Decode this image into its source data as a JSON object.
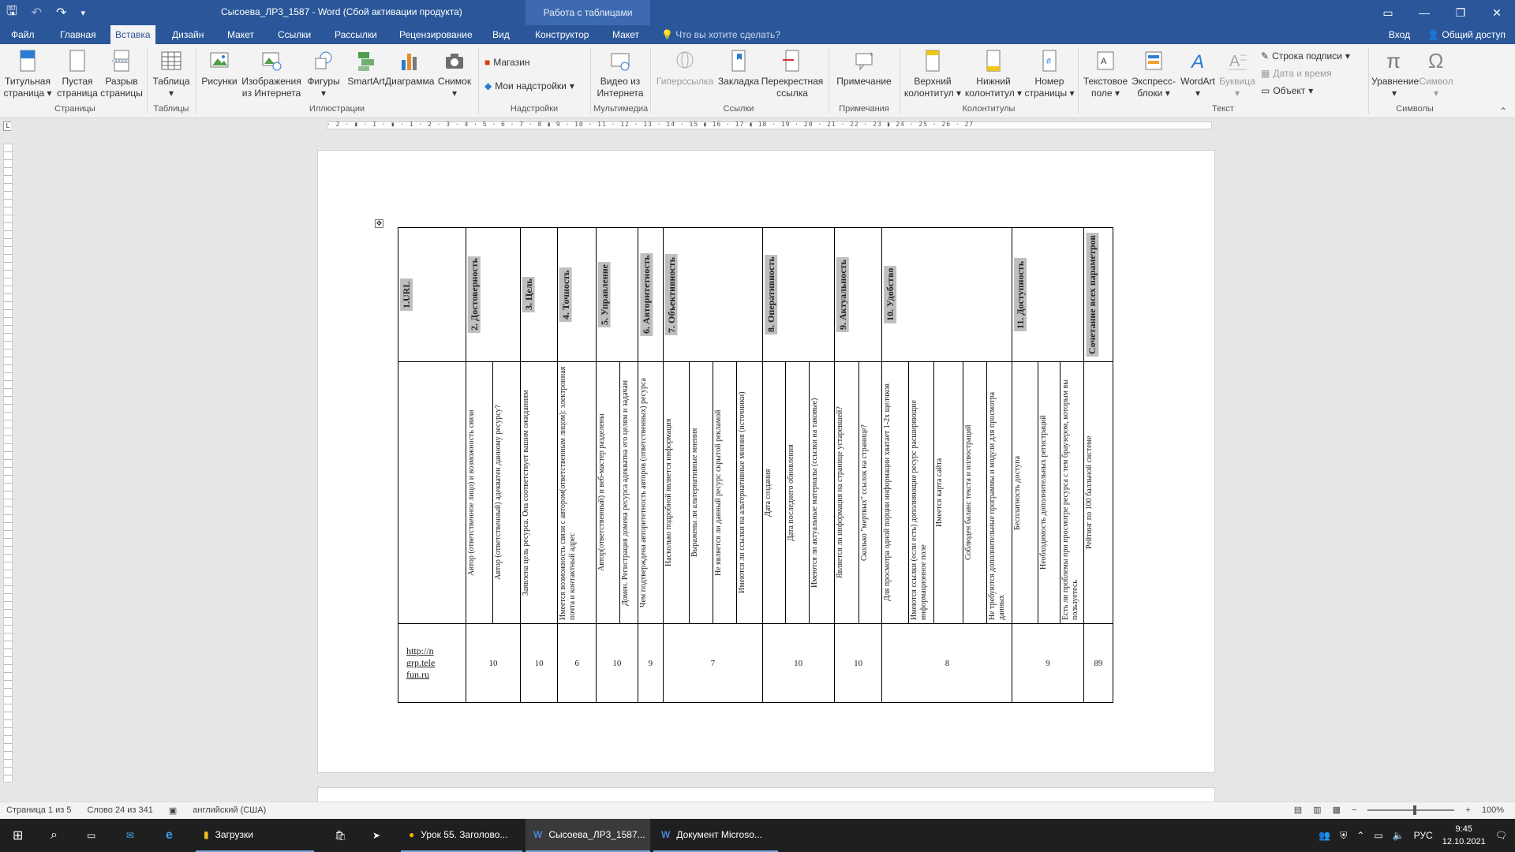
{
  "window": {
    "title": "Сысоева_ЛР3_1587 - Word (Сбой активации продукта)",
    "context_tab": "Работа с таблицами"
  },
  "tabs": [
    "Файл",
    "Главная",
    "Вставка",
    "Дизайн",
    "Макет",
    "Ссылки",
    "Рассылки",
    "Рецензирование",
    "Вид",
    "Конструктор",
    "Макет"
  ],
  "tell_me": "Что вы хотите сделать?",
  "signin": "Вход",
  "share": "Общий доступ",
  "ribbon": {
    "pages": {
      "cover": "Титульная страница",
      "blank": "Пустая страница",
      "break": "Разрыв страницы",
      "label": "Страницы"
    },
    "tables": {
      "table": "Таблица",
      "label": "Таблицы"
    },
    "illustrations": {
      "pictures": "Рисунки",
      "online": "Изображения из Интернета",
      "shapes": "Фигуры",
      "smartart": "SmartArt",
      "chart": "Диаграмма",
      "screenshot": "Снимок",
      "label": "Иллюстрации"
    },
    "addins": {
      "store": "Магазин",
      "myaddins": "Мои надстройки",
      "label": "Надстройки"
    },
    "media": {
      "video": "Видео из Интернета",
      "label": "Мультимедиа"
    },
    "links": {
      "hyperlink": "Гиперссылка",
      "bookmark": "Закладка",
      "crossref": "Перекрестная ссылка",
      "label": "Ссылки"
    },
    "comments": {
      "comment": "Примечание",
      "label": "Примечания"
    },
    "hf": {
      "header": "Верхний колонтитул",
      "footer": "Нижний колонтитул",
      "pagenum": "Номер страницы",
      "label": "Колонтитулы"
    },
    "text": {
      "textbox": "Текстовое поле",
      "quickparts": "Экспресс-блоки",
      "wordart": "WordArt",
      "dropcap": "Буквица",
      "sigline": "Строка подписи",
      "datetime": "Дата и время",
      "object": "Объект",
      "label": "Текст"
    },
    "symbols": {
      "equation": "Уравнение",
      "symbol": "Символ",
      "label": "Символы"
    }
  },
  "ruler_ticks": "· 2 · ▮ · 1 · ▮ · 1 · 2 · 3 · 4 · 5 · 6 · 7 · 8 ▮ 9 · 10 · 11 · 12 · 13 · 14 · 15 ▮ 16 · 17 ▮ 18 · 19 · 20 · 21 · 22 · 23 ▮ 24 · 25 · 26 · 27",
  "table": {
    "headers": [
      "1.URL",
      "2. Достоверность",
      "3. Цель",
      "4. Точность",
      "5. Управление",
      "6. Авторитетность",
      "7. Объективность",
      "8. Оперативность",
      "9. Актуальность",
      "10. Удобство",
      "11. Доступность",
      "Сочетание всех параметров"
    ],
    "subs": [
      [
        ""
      ],
      [
        "Автор (ответственное лицо) и возможность связи",
        "Автор (ответственный) адекватен данному ресурсу?"
      ],
      [
        "Заявлена цель ресурса. Она соответствует вашим ожиданиям"
      ],
      [
        "Имеется возможность связи с автором(ответственным лицом): электронная почта и контактный адрес"
      ],
      [
        "Автор(ответственный) и веб-мастер разделены",
        "Домен. Регистрация домена ресурса адекватна его целям и задачам"
      ],
      [
        "Чем подтверждена авторитетность авторов (ответственных) ресурса"
      ],
      [
        "Насколько подробной является информация",
        "Выражены ли альтернативные мнения",
        "Не является ли данный ресурс скрытой рекламой",
        "Имеются ли ссылки на альтернативные мнения (источники)"
      ],
      [
        "Дата создания",
        "Дата последнего обновления",
        "Имеются ли актуальные материалы (ссылки на таковые)"
      ],
      [
        "Является ли информация на странице устаревшей?",
        "Сколько \"мертвых\" ссылок на странице?"
      ],
      [
        "Для просмотра одной порции информации хватает 1-2х щелчков",
        "Имеются ссылки (если есть) дополняющие ресурс расширяющие информационное поле",
        "Имеется карта сайта",
        "Соблюден баланс текста и иллюстраций",
        "Не требуются дополнительные программы и модули для просмотра данных"
      ],
      [
        "Бесплатность доступа",
        "Необходимость дополнительных регистраций",
        "Есть ли проблемы при просмотре ресурса с тем браузером, которым вы пользуетесь"
      ],
      [
        "Рейтинг по 100 балльной системе"
      ]
    ],
    "url": "http://ngrp.telefun.ru",
    "scores": [
      "10",
      "10",
      "6",
      "10",
      "9",
      "7",
      "10",
      "10",
      "8",
      "9",
      "89"
    ]
  },
  "status": {
    "page": "Страница 1 из 5",
    "words": "Слово 24 из 341",
    "lang": "английский (США)",
    "zoom": "100%"
  },
  "taskbar": {
    "downloads": "Загрузки",
    "chrome": "Урок 55. Заголово...",
    "word1": "Сысоева_ЛР3_1587...",
    "word2": "Документ Microso...",
    "lang": "РУС",
    "time": "9:45",
    "date": "12.10.2021"
  }
}
